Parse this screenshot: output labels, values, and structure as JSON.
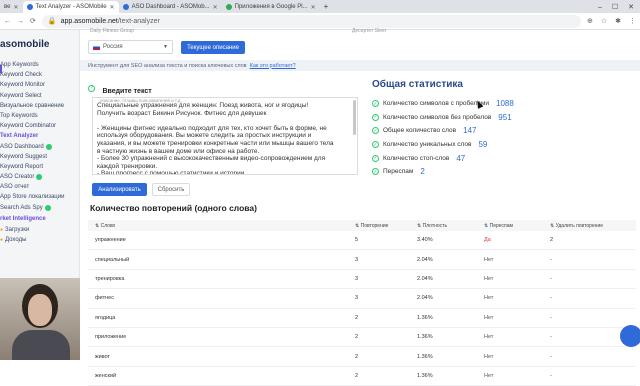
{
  "browser": {
    "tabs": [
      {
        "label": "Text Analyzer - ASOMobile",
        "active": true
      },
      {
        "label": "ASO Dashboard - ASOMob...",
        "active": false
      },
      {
        "label": "Приложения в Google Pl...",
        "active": false
      }
    ],
    "partial_tab": "ве",
    "url_host": "app.asomobile.net",
    "url_path": "/text-analyzer"
  },
  "sidebar": {
    "logo": "asomobile",
    "items": [
      {
        "label": "App Keywords",
        "badge": false
      },
      {
        "label": "Keyword Check",
        "badge": false
      },
      {
        "label": "Keyword Monitor",
        "badge": false
      },
      {
        "label": "Keyword Select",
        "badge": false
      },
      {
        "label": "Визуальное сравнение",
        "badge": false
      },
      {
        "label": "Top Keywords",
        "badge": false
      },
      {
        "label": "Keyword Combinator",
        "badge": false
      },
      {
        "label": "Text Analyzer",
        "badge": false,
        "active": true
      },
      {
        "label": "ASO Dashboard",
        "badge": true
      },
      {
        "label": "Keyword Suggest",
        "badge": false
      },
      {
        "label": "Keyword Report",
        "badge": false
      },
      {
        "label": "ASO Creator",
        "badge": true
      },
      {
        "label": "ASO отчет",
        "badge": false
      },
      {
        "label": "App Store локализации",
        "badge": false
      },
      {
        "label": "Search Ads Spy",
        "badge": true
      }
    ],
    "section2": "rket Intelligence",
    "section2_items": [
      {
        "label": "Загрузки"
      },
      {
        "label": "Доходы"
      }
    ]
  },
  "top": {
    "faded_left": "Daily Fitness Group",
    "faded_right": "Десертет Sleer",
    "country": "Россия",
    "current_desc_button": "Текущее описание"
  },
  "info": {
    "text": "Инструмент для SEO анализа текста и поиска ключевых слов",
    "link": "Как это работает?"
  },
  "input": {
    "title": "Введите текст",
    "subtitle": "описание, отзывы пользователей и т.д.",
    "lines": [
      "Специальные упражнения для женщин: Поезд живота, ног и ягодицы!",
      "Получить возраст Бикини Рисунок. Фитнес для девушек",
      "",
      "- Женщины фитнес идеально подходит для тех, кто хочет быть в форме, не",
      "используя оборудования. Вы можете следить за простых инструкции и",
      "указания, и вы можете тренировки конкретные части или мышцы вашего тела",
      "в частную жизнь в вашем доме или офисе на работе.",
      "- Более 30 упражнений с высококачественным видео-сопровождением для",
      "каждой тренировки.",
      "- Ваш прогресс с помощью статистики и истории"
    ],
    "analyze_button": "Анализировать",
    "reset_button": "Сбросить"
  },
  "stats": {
    "title": "Общая статистика",
    "rows": [
      {
        "label": "Количество символов с пробелами",
        "value": "1088"
      },
      {
        "label": "Количество символов без пробелов",
        "value": "951"
      },
      {
        "label": "Общее количество слов",
        "value": "147"
      },
      {
        "label": "Количество уникальных слов",
        "value": "59"
      },
      {
        "label": "Количество стоп-слов",
        "value": "47"
      },
      {
        "label": "Переспам",
        "value": "2"
      }
    ]
  },
  "repetitions": {
    "title": "Количество повторений (одного слова)",
    "headers": [
      "Слово",
      "Повторение",
      "Плотность",
      "Переспам",
      "Удалить повторение"
    ],
    "rows": [
      {
        "word": "упражнение",
        "count": "5",
        "density": "3.40%",
        "spam": "Да",
        "remove": "2"
      },
      {
        "word": "специальный",
        "count": "3",
        "density": "2.04%",
        "spam": "Нет",
        "remove": "-"
      },
      {
        "word": "тренировка",
        "count": "3",
        "density": "2.04%",
        "spam": "Нет",
        "remove": "-"
      },
      {
        "word": "фитнес",
        "count": "3",
        "density": "2.04%",
        "spam": "Нет",
        "remove": "-"
      },
      {
        "word": "ягодица",
        "count": "2",
        "density": "1.36%",
        "spam": "Нет",
        "remove": "-"
      },
      {
        "word": "приложение",
        "count": "2",
        "density": "1.36%",
        "spam": "Нет",
        "remove": "-"
      },
      {
        "word": "живот",
        "count": "2",
        "density": "1.36%",
        "spam": "Нет",
        "remove": "-"
      },
      {
        "word": "женский",
        "count": "2",
        "density": "1.36%",
        "spam": "Нет",
        "remove": "-"
      }
    ]
  },
  "colors": {
    "accent": "#2f6bd8",
    "title": "#2b4a8a",
    "success": "#2ecc71",
    "danger": "#e03a3a"
  }
}
